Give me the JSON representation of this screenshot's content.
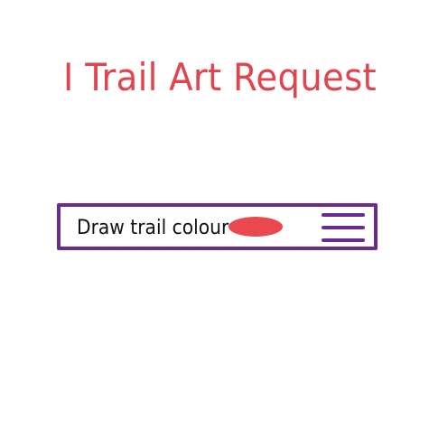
{
  "header": {
    "title": "I Trail Art Request",
    "title_color": "#e0454f"
  },
  "request_row": {
    "label": "Draw trail colour",
    "selected_colour": "#e8484e",
    "border_color": "#6a2c91",
    "menu_icon": "hamburger-menu-icon"
  }
}
